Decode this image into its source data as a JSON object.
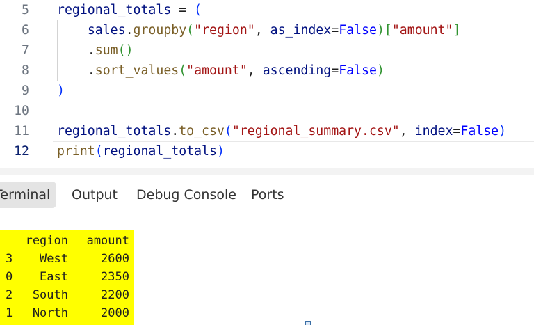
{
  "editor": {
    "lines": [
      {
        "number": "5",
        "tokens": [
          {
            "text": "regional_totals",
            "type": "var"
          },
          {
            "text": " = ",
            "type": "pn"
          },
          {
            "text": "(",
            "type": "br1"
          }
        ]
      },
      {
        "number": "6",
        "tokens": [
          {
            "text": "    ",
            "type": "pn"
          },
          {
            "text": "sales",
            "type": "var"
          },
          {
            "text": ".",
            "type": "pn"
          },
          {
            "text": "groupby",
            "type": "fn"
          },
          {
            "text": "(",
            "type": "br2"
          },
          {
            "text": "\"region\"",
            "type": "str"
          },
          {
            "text": ", ",
            "type": "pn"
          },
          {
            "text": "as_index",
            "type": "var"
          },
          {
            "text": "=",
            "type": "pn"
          },
          {
            "text": "False",
            "type": "kw"
          },
          {
            "text": ")",
            "type": "br2"
          },
          {
            "text": "[",
            "type": "br2"
          },
          {
            "text": "\"amount\"",
            "type": "str"
          },
          {
            "text": "]",
            "type": "br2"
          }
        ]
      },
      {
        "number": "7",
        "tokens": [
          {
            "text": "    ",
            "type": "pn"
          },
          {
            "text": ".",
            "type": "pn"
          },
          {
            "text": "sum",
            "type": "fn"
          },
          {
            "text": "()",
            "type": "br2"
          }
        ]
      },
      {
        "number": "8",
        "tokens": [
          {
            "text": "    ",
            "type": "pn"
          },
          {
            "text": ".",
            "type": "pn"
          },
          {
            "text": "sort_values",
            "type": "fn"
          },
          {
            "text": "(",
            "type": "br2"
          },
          {
            "text": "\"amount\"",
            "type": "str"
          },
          {
            "text": ", ",
            "type": "pn"
          },
          {
            "text": "ascending",
            "type": "var"
          },
          {
            "text": "=",
            "type": "pn"
          },
          {
            "text": "False",
            "type": "kw"
          },
          {
            "text": ")",
            "type": "br2"
          }
        ]
      },
      {
        "number": "9",
        "tokens": [
          {
            "text": ")",
            "type": "br1"
          }
        ]
      },
      {
        "number": "10",
        "tokens": []
      },
      {
        "number": "11",
        "tokens": [
          {
            "text": "regional_totals",
            "type": "var"
          },
          {
            "text": ".",
            "type": "pn"
          },
          {
            "text": "to_csv",
            "type": "fn"
          },
          {
            "text": "(",
            "type": "br1"
          },
          {
            "text": "\"regional_summary.csv\"",
            "type": "str"
          },
          {
            "text": ", ",
            "type": "pn"
          },
          {
            "text": "index",
            "type": "var"
          },
          {
            "text": "=",
            "type": "pn"
          },
          {
            "text": "False",
            "type": "kw"
          },
          {
            "text": ")",
            "type": "br1"
          }
        ]
      },
      {
        "number": "12",
        "current": true,
        "tokens": [
          {
            "text": "print",
            "type": "fn"
          },
          {
            "text": "(",
            "type": "br1"
          },
          {
            "text": "regional_totals",
            "type": "var"
          },
          {
            "text": ")",
            "type": "br1"
          }
        ]
      }
    ]
  },
  "panel": {
    "tabs": [
      {
        "label": "Terminal",
        "active": true
      },
      {
        "label": "Output"
      },
      {
        "label": "Debug Console"
      },
      {
        "label": "Ports"
      }
    ]
  },
  "terminal": {
    "headers": {
      "region": "region",
      "amount": "amount"
    },
    "rows": [
      {
        "index": "3",
        "region": "West",
        "amount": "2600"
      },
      {
        "index": "0",
        "region": "East",
        "amount": "2350"
      },
      {
        "index": "2",
        "region": "South",
        "amount": "2200"
      },
      {
        "index": "1",
        "region": "North",
        "amount": "2000"
      }
    ],
    "highlight_color": "#ffff00"
  },
  "colors": {
    "string": "#a31515",
    "keyword": "#0000ff",
    "variable": "#001080",
    "function": "#795e26",
    "bracket_outer": "#0431fa",
    "bracket_inner": "#319331"
  }
}
